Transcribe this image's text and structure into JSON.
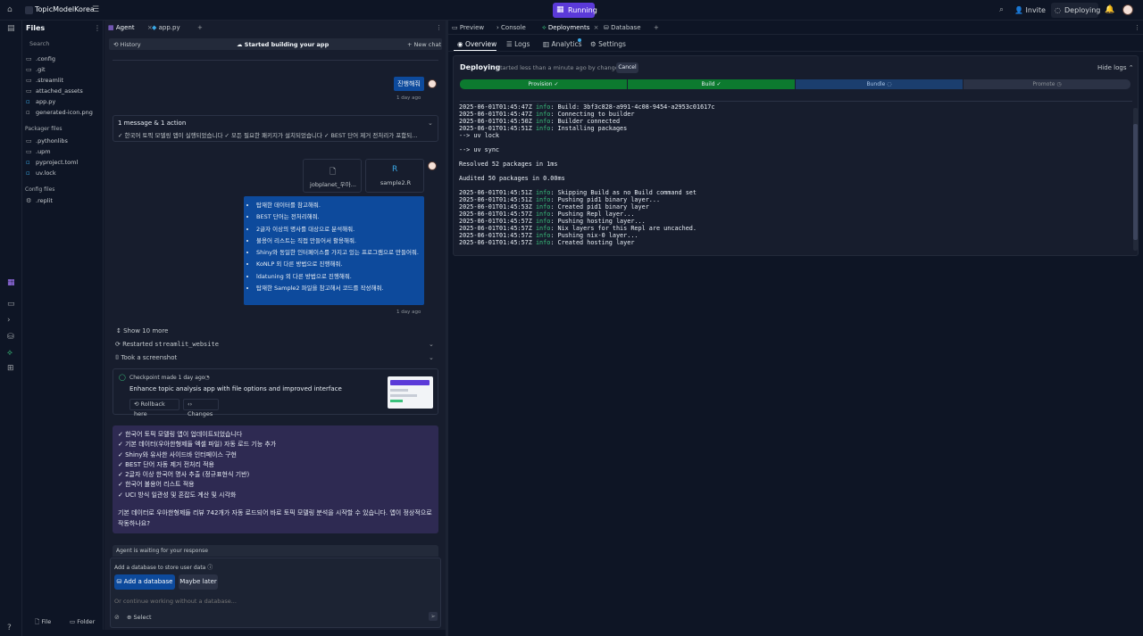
{
  "top": {
    "project_name": "TopicModelKorea",
    "run_label": "Running",
    "invite_label": "Invite",
    "deploying_label": "Deploying"
  },
  "files": {
    "title": "Files",
    "search_placeholder": "Search",
    "items": [
      ".config",
      ".git",
      ".streamlit",
      "attached_assets",
      "app.py",
      "generated-icon.png"
    ],
    "packager_title": "Packager files",
    "packager_items": [
      ".pythonlibs",
      ".upm",
      "pyproject.toml",
      "uv.lock"
    ],
    "config_title": "Config files",
    "config_items": [
      ".replit"
    ],
    "file_btn": "File",
    "folder_btn": "Folder"
  },
  "agent": {
    "tab_agent": "Agent",
    "tab_app": "app.py",
    "history": "History",
    "status": "Started building your app",
    "new_chat": "New chat",
    "msg1": "진행해줘",
    "ts1": "1 day ago",
    "action_title": "1 message & 1 action",
    "action_summary": "✓ 한국어 토픽 모델링 앱이 실행되었습니다 ✓ 모든 필요한 패키지가 설치되었습니다 ✓ BEST 단어 제거 전처리가 포함되...",
    "attach1": "jobplanet_우아...",
    "attach2": "sample2.R",
    "requests": [
      "탑재한 데이터를 참고해줘.",
      "BEST 단어는 전처리해줘.",
      "2글자 이상의 명사를 대상으로 분석해줘.",
      "불용어 리스트는 직접 만들어서 활용해줘.",
      "Shiny와 동일한 인터페이스를 가지고 있는 프로그램으로 만들어줘.",
      "KoNLP 외 다른 방법으로 진행해줘.",
      "ldatuning 외 다른 방법으로 진행해줘.",
      "탑재한 Sample2 파일을 참고해서 코드를 작성해줘."
    ],
    "ts2": "1 day ago",
    "show_more": "Show 10 more",
    "restarted_prefix": "Restarted",
    "restarted_name": "streamlit_website",
    "screenshot": "Took a screenshot",
    "checkpoint": "Checkpoint made 1 day ago",
    "checkpoint_desc": "Enhance topic analysis app with file options and improved interface",
    "rollback": "Rollback here",
    "changes": "Changes",
    "summary_items": [
      "✓ 한국어 토픽 모델링 앱이 업데이트되었습니다",
      "✓ 기본 데이터(우아한형제들 엑셀 파일) 자동 로드 기능 추가",
      "✓ Shiny와 유사한 사이드바 인터페이스 구현",
      "✓ BEST 단어 자동 제거 전처리 적용",
      "✓ 2글자 이상 한국어 명사 추출 (정규표현식 기반)",
      "✓ 한국어 불용어 리스트 적용",
      "✓ UCI 방식 일관성 및 혼잡도 계산 및 시각화"
    ],
    "summary_question": "기본 데이터로 우아한형제들 리뷰 742개가 자동 로드되어 바로 토픽 모델링 분석을 시작할 수 있습니다. 앱이 정상적으로 작동하나요?",
    "waiting": "Agent is waiting for your response",
    "db_prompt": "Add a database to store user data",
    "add_db": "Add a database",
    "maybe_later": "Maybe later",
    "input_placeholder": "Or continue working without a database...",
    "select": "Select"
  },
  "right": {
    "tabs": [
      "Preview",
      "Console",
      "Deployments",
      "Database"
    ],
    "subtabs": [
      "Overview",
      "Logs",
      "Analytics",
      "Settings"
    ],
    "deploy_title": "Deploying",
    "deploy_sub": "Started less than a minute ago by change",
    "cancel": "Cancel",
    "hide_logs": "Hide logs",
    "stages": [
      "Provision ✓",
      "Build ✓",
      "Bundle",
      "Promote"
    ],
    "stage_progress": {
      "done": 2,
      "active": 1,
      "pending": 1
    }
  },
  "logs": [
    {
      "ts": "2025-06-01T01:45:47Z",
      "lvl": "info",
      "msg": ": Build: 3bf3c828-a991-4c08-9454-a2953c01617c"
    },
    {
      "ts": "2025-06-01T01:45:47Z",
      "lvl": "info",
      "msg": ": Connecting to builder"
    },
    {
      "ts": "2025-06-01T01:45:50Z",
      "lvl": "info",
      "msg": ": Builder connected"
    },
    {
      "ts": "2025-06-01T01:45:51Z",
      "lvl": "info",
      "msg": ": Installing packages"
    },
    {
      "raw": "--> uv lock"
    },
    {
      "raw": ""
    },
    {
      "raw": "--> uv sync"
    },
    {
      "raw": ""
    },
    {
      "raw": "Resolved 52 packages in 1ms"
    },
    {
      "raw": ""
    },
    {
      "raw": "Audited 50 packages in 0.00ms"
    },
    {
      "raw": ""
    },
    {
      "ts": "2025-06-01T01:45:51Z",
      "lvl": "info",
      "msg": ": Skipping Build as no Build command set"
    },
    {
      "ts": "2025-06-01T01:45:51Z",
      "lvl": "info",
      "msg": ": Pushing pid1 binary layer..."
    },
    {
      "ts": "2025-06-01T01:45:53Z",
      "lvl": "info",
      "msg": ": Created pid1 binary layer"
    },
    {
      "ts": "2025-06-01T01:45:57Z",
      "lvl": "info",
      "msg": ": Pushing Repl layer..."
    },
    {
      "ts": "2025-06-01T01:45:57Z",
      "lvl": "info",
      "msg": ": Pushing hosting layer..."
    },
    {
      "ts": "2025-06-01T01:45:57Z",
      "lvl": "info",
      "msg": ": Nix layers for this Repl are uncached."
    },
    {
      "ts": "2025-06-01T01:45:57Z",
      "lvl": "info",
      "msg": ": Pushing nix-0 layer..."
    },
    {
      "ts": "2025-06-01T01:45:57Z",
      "lvl": "info",
      "msg": ": Created hosting layer"
    }
  ]
}
